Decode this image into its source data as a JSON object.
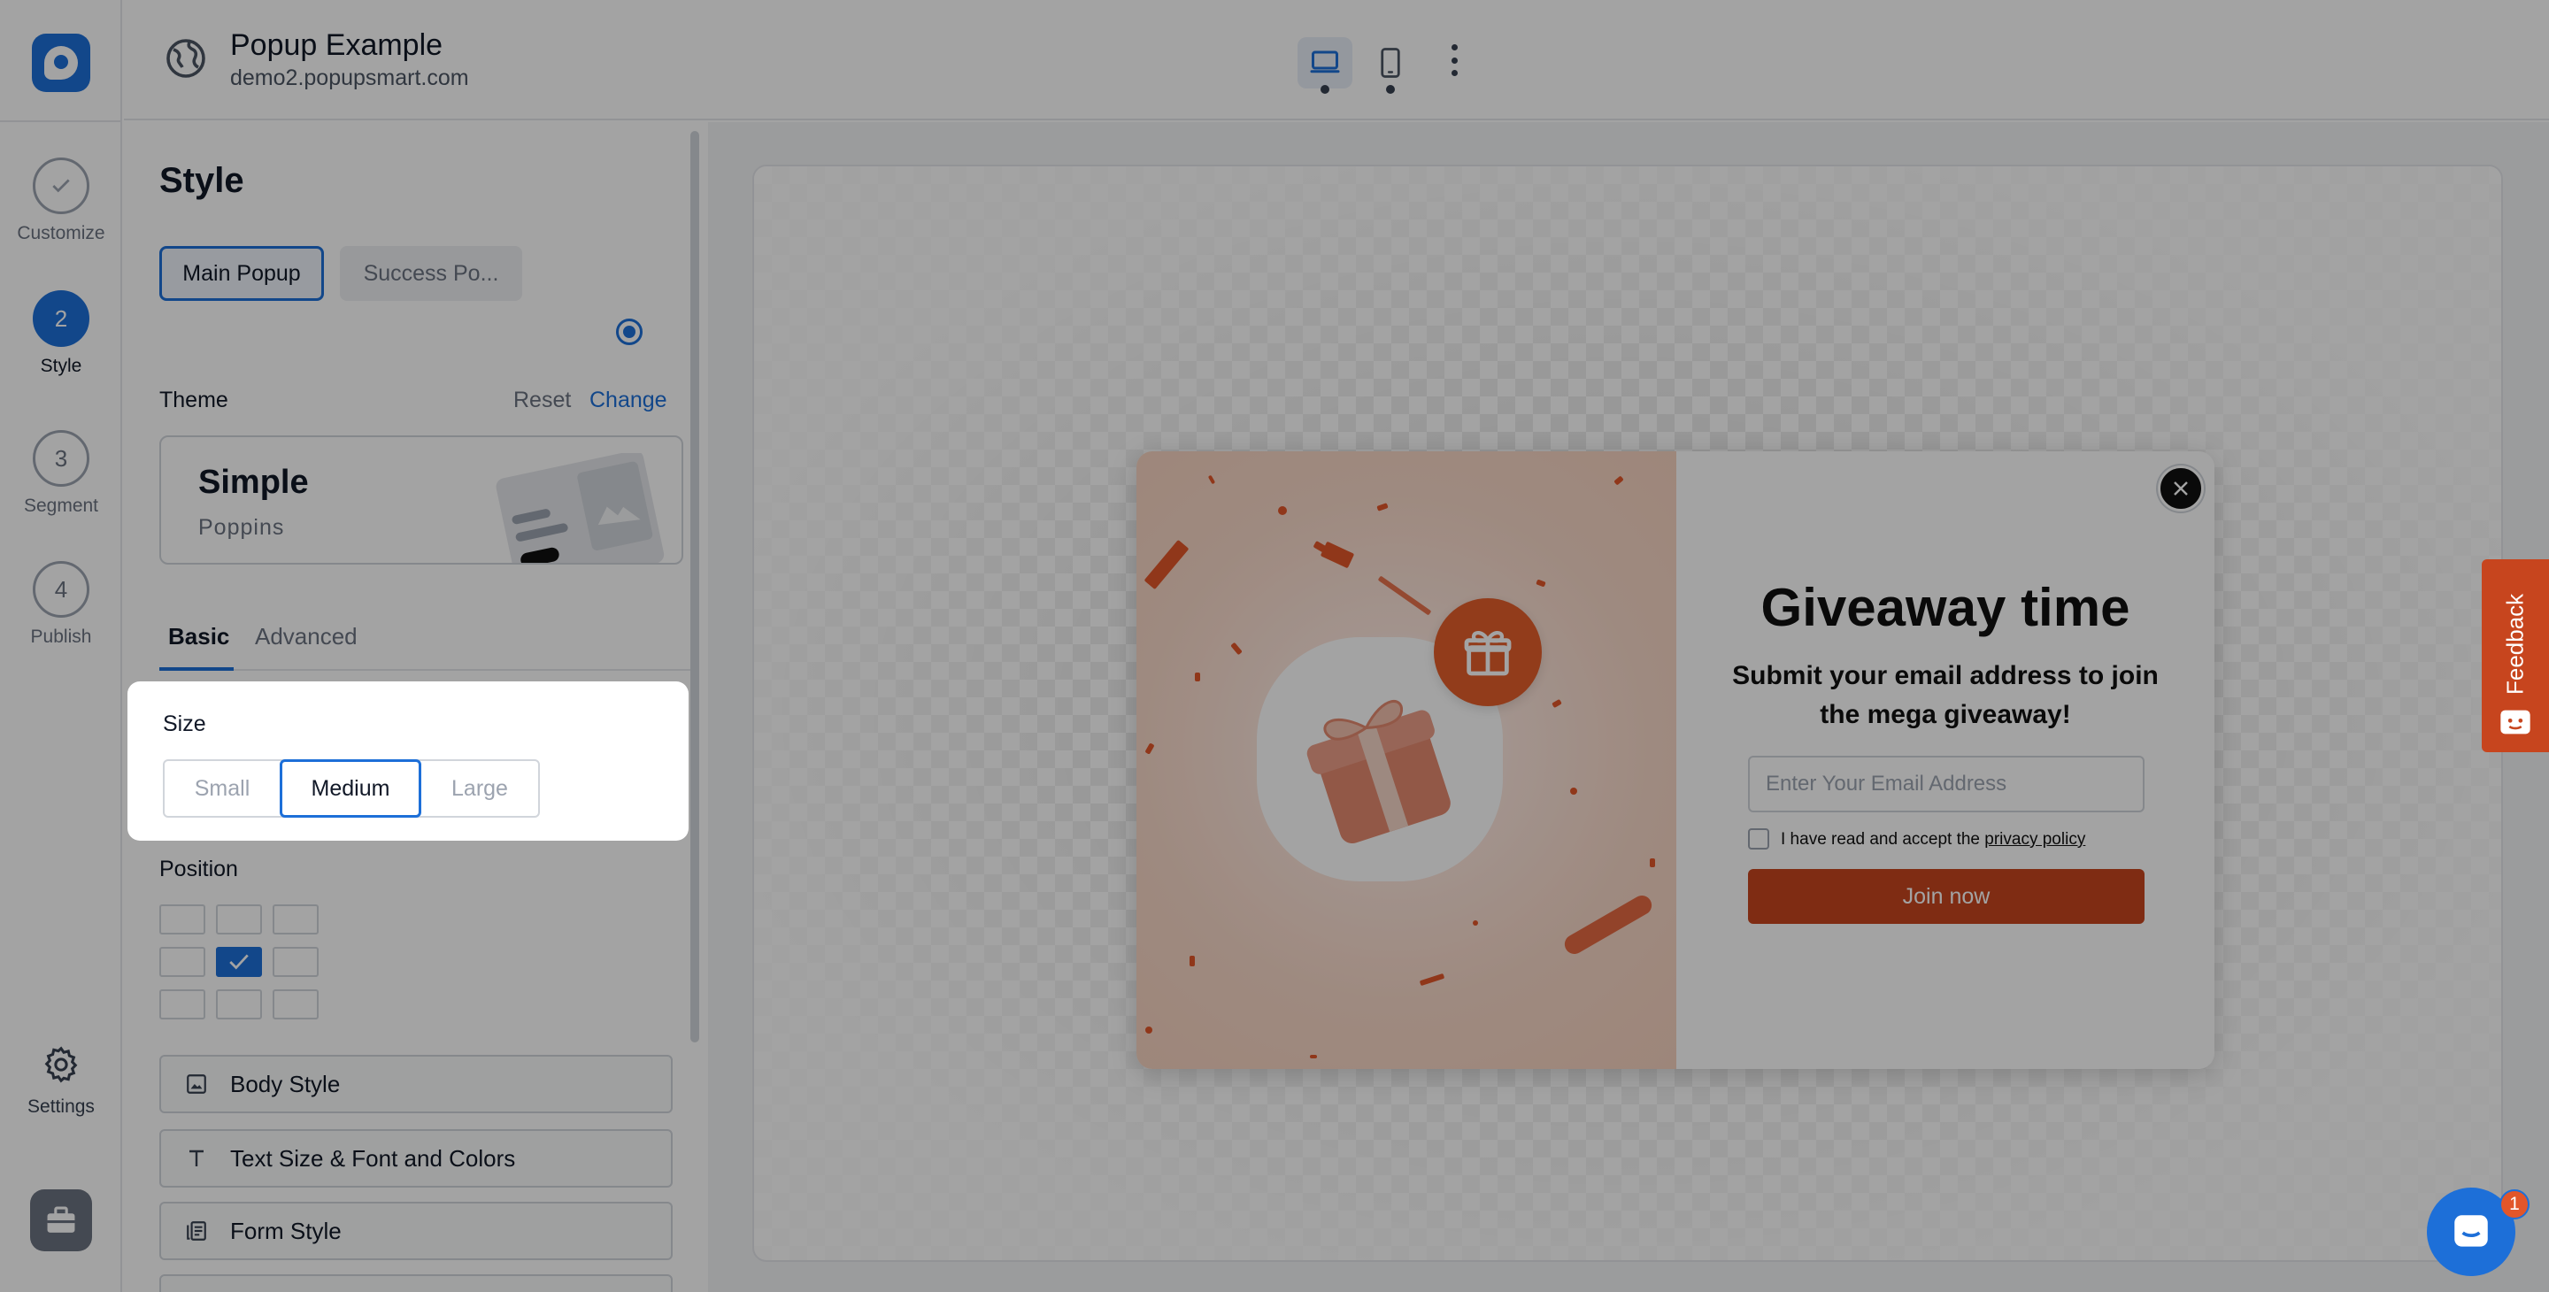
{
  "colors": {
    "accent": "#1d6fd8",
    "popup_button": "#c7451e",
    "feedback": "#c7451e"
  },
  "rail": {
    "steps": [
      {
        "label": "Customize",
        "state": "done",
        "icon": "check-icon"
      },
      {
        "label": "Style",
        "number": "2",
        "state": "active"
      },
      {
        "label": "Segment",
        "number": "3",
        "state": "todo"
      },
      {
        "label": "Publish",
        "number": "4",
        "state": "todo"
      }
    ],
    "settings_label": "Settings"
  },
  "header": {
    "title": "Popup Example",
    "url": "demo2.popupsmart.com",
    "devices": [
      {
        "name": "desktop",
        "active": true
      },
      {
        "name": "mobile",
        "active": false
      }
    ]
  },
  "panel": {
    "title": "Style",
    "tabs": [
      {
        "label": "Main Popup",
        "active": true
      },
      {
        "label": "Success Po...",
        "active": false
      }
    ],
    "theme": {
      "label": "Theme",
      "reset": "Reset",
      "change": "Change",
      "name": "Simple",
      "font": "Poppins"
    },
    "subtabs": [
      {
        "label": "Basic",
        "active": true
      },
      {
        "label": "Advanced",
        "active": false
      }
    ],
    "size": {
      "label": "Size",
      "options": [
        "Small",
        "Medium",
        "Large"
      ],
      "selected": "Medium"
    },
    "position": {
      "label": "Position",
      "selected_row": 2,
      "selected_col": 2
    },
    "sections": [
      {
        "label": "Body Style",
        "icon": "image-icon"
      },
      {
        "label": "Text Size & Font and Colors",
        "icon": "text-icon"
      },
      {
        "label": "Form Style",
        "icon": "form-icon"
      }
    ]
  },
  "popup": {
    "title": "Giveaway time",
    "subtitle": "Submit your email address to join the mega giveaway!",
    "email_placeholder": "Enter Your Email Address",
    "consent_text": "I have read and accept the ",
    "consent_link": "privacy policy",
    "button": "Join now"
  },
  "widgets": {
    "feedback": "Feedback",
    "chat_badge": "1"
  }
}
